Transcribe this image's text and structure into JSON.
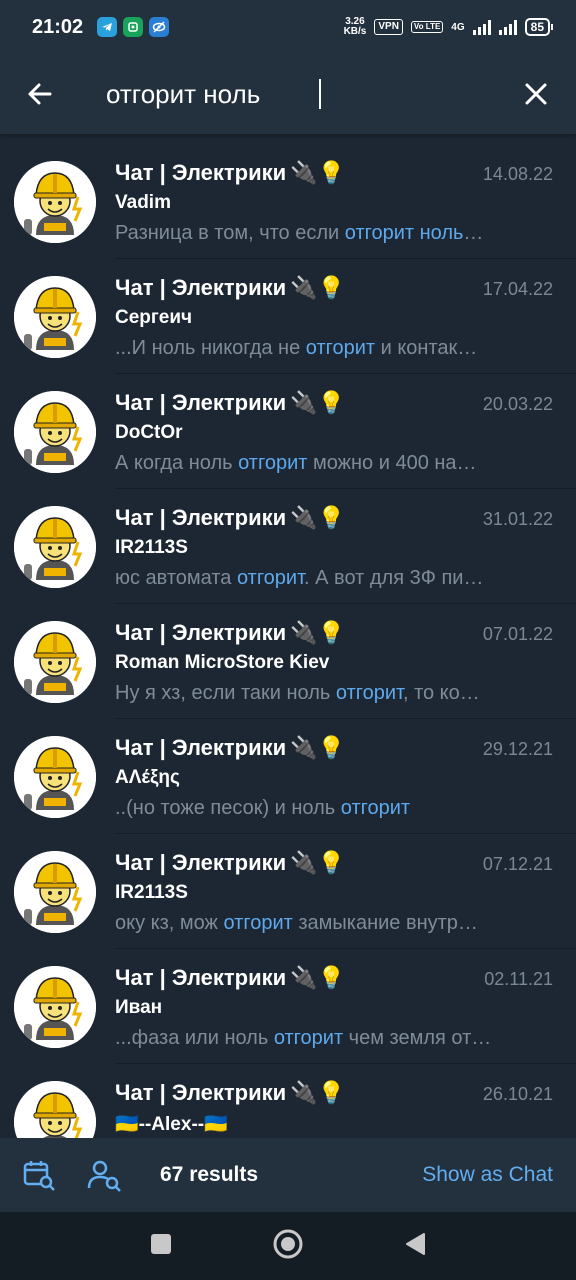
{
  "status_bar": {
    "time": "21:02",
    "speed_value": "3.26",
    "speed_unit": "KB/s",
    "vpn": "VPN",
    "volte": "Vo LTE",
    "network": "4G",
    "battery": "85"
  },
  "search": {
    "query": "отгорит ноль"
  },
  "results": [
    {
      "chat": "Чат | Электрики",
      "emoji": "🔌💡",
      "date": "14.08.22",
      "sender": "Vadim",
      "before": "Разница в том, что если ",
      "highlight": "отгорит ноль",
      "after": "…"
    },
    {
      "chat": "Чат | Электрики",
      "emoji": "🔌💡",
      "date": "17.04.22",
      "sender": "Сергеич",
      "before": "...И ноль никогда не ",
      "highlight": "отгорит",
      "after": " и контак…"
    },
    {
      "chat": "Чат | Электрики",
      "emoji": "🔌💡",
      "date": "20.03.22",
      "sender": "DoCtOr",
      "before": "А когда ноль ",
      "highlight": "отгорит",
      "after": " можно и 400 на…"
    },
    {
      "chat": "Чат | Электрики",
      "emoji": "🔌💡",
      "date": "31.01.22",
      "sender": "IR2113S",
      "before": "юс автомата ",
      "highlight": "отгорит",
      "after": ". А вот для 3Ф пи…"
    },
    {
      "chat": "Чат | Электрики",
      "emoji": "🔌💡",
      "date": "07.01.22",
      "sender": "Roman MicroStore Kiev",
      "before": "Ну я хз, если таки ноль ",
      "highlight": "отгорит",
      "after": ", то ко…"
    },
    {
      "chat": "Чат | Электрики",
      "emoji": "🔌💡",
      "date": "29.12.21",
      "sender": "ΑΛέξης",
      "before": "..(но тоже песок) и ноль ",
      "highlight": "отгорит",
      "after": ""
    },
    {
      "chat": "Чат | Электрики",
      "emoji": "🔌💡",
      "date": "07.12.21",
      "sender": "IR2113S",
      "before": "оку кз, мож ",
      "highlight": "отгорит",
      "after": " замыкание внутр…"
    },
    {
      "chat": "Чат | Электрики",
      "emoji": "🔌💡",
      "date": "02.11.21",
      "sender": "Иван",
      "before": "...фаза или ноль ",
      "highlight": "отгорит",
      "after": " чем земля от…"
    },
    {
      "chat": "Чат | Электрики",
      "emoji": "🔌💡",
      "date": "26.10.21",
      "sender": "🇺🇦--Alex--🇺🇦",
      "before": "",
      "highlight": "",
      "after": ""
    }
  ],
  "bottom_bar": {
    "results_count": "67 results",
    "show_as_chat": "Show as Chat"
  },
  "colors": {
    "background": "#1c2733",
    "header": "#23303e",
    "highlight": "#5ea9ec",
    "accent": "#62aef0"
  }
}
